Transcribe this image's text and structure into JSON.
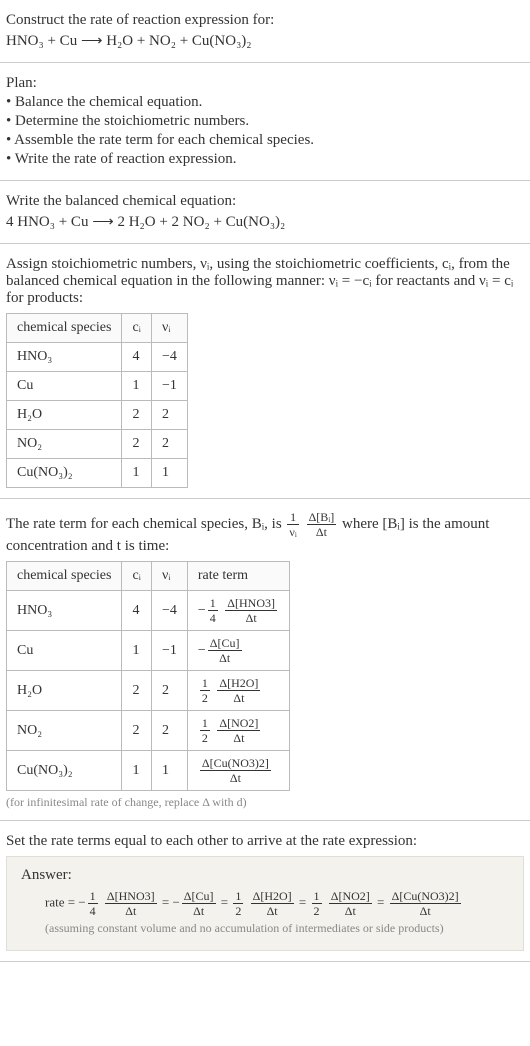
{
  "intro": {
    "prompt": "Construct the rate of reaction expression for:",
    "equation": "HNO₃ + Cu ⟶ H₂O + NO₂ + Cu(NO₃)₂"
  },
  "plan": {
    "heading": "Plan:",
    "items": [
      "• Balance the chemical equation.",
      "• Determine the stoichiometric numbers.",
      "• Assemble the rate term for each chemical species.",
      "• Write the rate of reaction expression."
    ]
  },
  "balanced": {
    "heading": "Write the balanced chemical equation:",
    "equation": "4 HNO₃ + Cu ⟶ 2 H₂O + 2 NO₂ + Cu(NO₃)₂"
  },
  "stoich": {
    "text_a": "Assign stoichiometric numbers, νᵢ, using the stoichiometric coefficients, cᵢ, from the balanced chemical equation in the following manner: νᵢ = −cᵢ for reactants and νᵢ = cᵢ for products:",
    "headers": [
      "chemical species",
      "cᵢ",
      "νᵢ"
    ],
    "rows": [
      {
        "species": "HNO₃",
        "c": "4",
        "v": "−4"
      },
      {
        "species": "Cu",
        "c": "1",
        "v": "−1"
      },
      {
        "species": "H₂O",
        "c": "2",
        "v": "2"
      },
      {
        "species": "NO₂",
        "c": "2",
        "v": "2"
      },
      {
        "species": "Cu(NO₃)₂",
        "c": "1",
        "v": "1"
      }
    ]
  },
  "rateterm": {
    "text_a": "The rate term for each chemical species, Bᵢ, is ",
    "text_b": " where [Bᵢ] is the amount concentration and t is time:",
    "headers": [
      "chemical species",
      "cᵢ",
      "νᵢ",
      "rate term"
    ],
    "rows": [
      {
        "species": "HNO₃",
        "c": "4",
        "v": "−4",
        "coef_num": "1",
        "coef_den": "4",
        "sign": "−",
        "d_num": "Δ[HNO3]",
        "d_den": "Δt"
      },
      {
        "species": "Cu",
        "c": "1",
        "v": "−1",
        "coef_num": "",
        "coef_den": "",
        "sign": "−",
        "d_num": "Δ[Cu]",
        "d_den": "Δt"
      },
      {
        "species": "H₂O",
        "c": "2",
        "v": "2",
        "coef_num": "1",
        "coef_den": "2",
        "sign": "",
        "d_num": "Δ[H2O]",
        "d_den": "Δt"
      },
      {
        "species": "NO₂",
        "c": "2",
        "v": "2",
        "coef_num": "1",
        "coef_den": "2",
        "sign": "",
        "d_num": "Δ[NO2]",
        "d_den": "Δt"
      },
      {
        "species": "Cu(NO₃)₂",
        "c": "1",
        "v": "1",
        "coef_num": "",
        "coef_den": "",
        "sign": "",
        "d_num": "Δ[Cu(NO3)2]",
        "d_den": "Δt"
      }
    ],
    "caption": "(for infinitesimal rate of change, replace Δ with d)"
  },
  "final": {
    "heading": "Set the rate terms equal to each other to arrive at the rate expression:",
    "answer_label": "Answer:",
    "rate_prefix": "rate = ",
    "terms": [
      {
        "sign": "−",
        "coef_num": "1",
        "coef_den": "4",
        "d_num": "Δ[HNO3]",
        "d_den": "Δt"
      },
      {
        "sign": "−",
        "coef_num": "",
        "coef_den": "",
        "d_num": "Δ[Cu]",
        "d_den": "Δt"
      },
      {
        "sign": "",
        "coef_num": "1",
        "coef_den": "2",
        "d_num": "Δ[H2O]",
        "d_den": "Δt"
      },
      {
        "sign": "",
        "coef_num": "1",
        "coef_den": "2",
        "d_num": "Δ[NO2]",
        "d_den": "Δt"
      },
      {
        "sign": "",
        "coef_num": "",
        "coef_den": "",
        "d_num": "Δ[Cu(NO3)2]",
        "d_den": "Δt"
      }
    ],
    "eq": " = ",
    "assumption": "(assuming constant volume and no accumulation of intermediates or side products)"
  },
  "chart_data": {
    "type": "table",
    "tables": [
      {
        "title": "Stoichiometric numbers",
        "columns": [
          "chemical species",
          "cᵢ",
          "νᵢ"
        ],
        "rows": [
          [
            "HNO₃",
            4,
            -4
          ],
          [
            "Cu",
            1,
            -1
          ],
          [
            "H₂O",
            2,
            2
          ],
          [
            "NO₂",
            2,
            2
          ],
          [
            "Cu(NO₃)₂",
            1,
            1
          ]
        ]
      },
      {
        "title": "Rate terms",
        "columns": [
          "chemical species",
          "cᵢ",
          "νᵢ",
          "rate term"
        ],
        "rows": [
          [
            "HNO₃",
            4,
            -4,
            "−(1/4) Δ[HNO3]/Δt"
          ],
          [
            "Cu",
            1,
            -1,
            "−Δ[Cu]/Δt"
          ],
          [
            "H₂O",
            2,
            2,
            "(1/2) Δ[H2O]/Δt"
          ],
          [
            "NO₂",
            2,
            2,
            "(1/2) Δ[NO2]/Δt"
          ],
          [
            "Cu(NO₃)₂",
            1,
            1,
            "Δ[Cu(NO3)2]/Δt"
          ]
        ]
      }
    ]
  }
}
